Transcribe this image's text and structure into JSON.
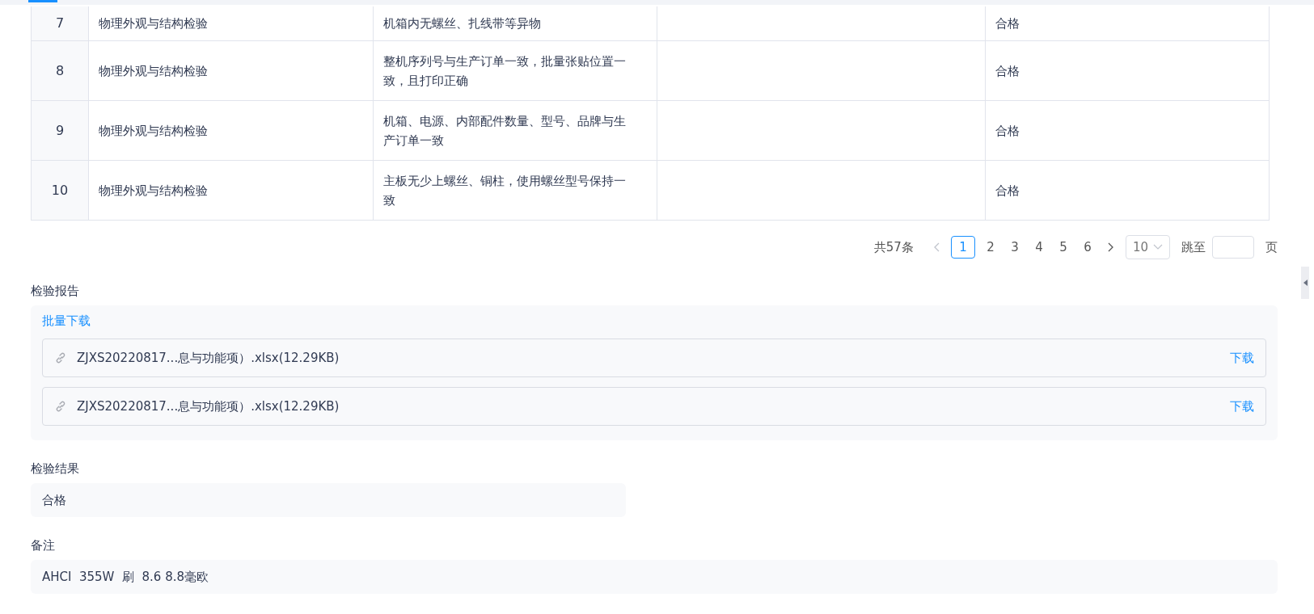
{
  "table": {
    "rows": [
      {
        "index": "7",
        "category": "物理外观与结构检验",
        "requirement": "机箱内无螺丝、扎线带等异物",
        "column_4": "",
        "result": "合格"
      },
      {
        "index": "8",
        "category": "物理外观与结构检验",
        "requirement": "整机序列号与生产订单一致，批量张贴位置一致，且打印正确",
        "column_4": "",
        "result": "合格"
      },
      {
        "index": "9",
        "category": "物理外观与结构检验",
        "requirement": "机箱、电源、内部配件数量、型号、品牌与生产订单一致",
        "column_4": "",
        "result": "合格"
      },
      {
        "index": "10",
        "category": "物理外观与结构检验",
        "requirement": "主板无少上螺丝、铜柱，使用螺丝型号保持一致",
        "column_4": "",
        "result": "合格"
      }
    ]
  },
  "pagination": {
    "total": "共57条",
    "prev_disabled": true,
    "pages": [
      {
        "label": "1",
        "selected": true
      },
      {
        "label": "2",
        "selected": false
      },
      {
        "label": "3",
        "selected": false
      },
      {
        "label": "4",
        "selected": false
      },
      {
        "label": "5",
        "selected": false
      },
      {
        "label": "6",
        "selected": false
      }
    ],
    "page_size": "10",
    "jump_label": "跳至",
    "jump_suffix": "页"
  },
  "report": {
    "label": "检验报告",
    "batch_download": "批量下载",
    "files": [
      {
        "name": "ZJXS20220817...息与功能项）.xlsx(12.29KB)",
        "action": "下载"
      },
      {
        "name": "ZJXS20220817...息与功能项）.xlsx(12.29KB)",
        "action": "下载"
      }
    ]
  },
  "result": {
    "label": "检验结果",
    "value": "合格"
  },
  "remarks": {
    "label": "备注",
    "value": "AHCI  355W  刷  8.6 8.8毫欧"
  }
}
